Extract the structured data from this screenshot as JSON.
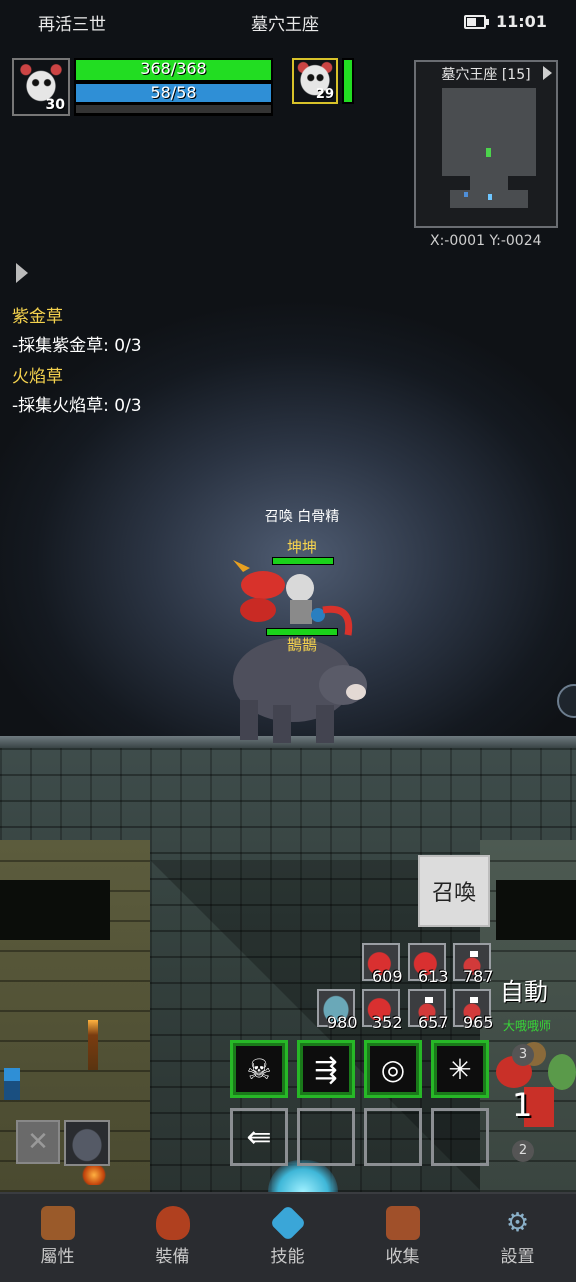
{
  "status_bar": {
    "left_text": "再活三世",
    "center_text": "墓穴王座",
    "time": "11:01"
  },
  "player": {
    "level": "30",
    "hp_text": "368/368",
    "mp_text": "58/58"
  },
  "pet": {
    "level": "29"
  },
  "minimap": {
    "title": "墓穴王座 [15]",
    "coords": "X:-0001  Y:-0024"
  },
  "quests": [
    {
      "title": "紫金草",
      "line": "-採集紫金草: 0/3"
    },
    {
      "title": "火焰草",
      "line": "-採集火焰草: 0/3"
    }
  ],
  "creatures": {
    "summon_label": "召喚 白骨精",
    "name_top": "坤坤",
    "name_bottom": "鵲鵲"
  },
  "summon_button": {
    "label": "召喚"
  },
  "items": [
    {
      "icon": "meat-icon",
      "count": "609"
    },
    {
      "icon": "meat-icon",
      "count": "613"
    },
    {
      "icon": "potion-icon",
      "count": "787"
    },
    {
      "icon": "fish-icon",
      "count": "980"
    },
    {
      "icon": "meat-icon",
      "count": "352"
    },
    {
      "icon": "potion-icon",
      "count": "657"
    },
    {
      "icon": "potion-icon",
      "count": "965"
    }
  ],
  "auto_button": {
    "label": "自動"
  },
  "ally": {
    "name": "大哦哦师",
    "count": "1",
    "badge_top": "3",
    "badge_bottom": "2"
  },
  "skills": [
    {
      "icon": "horned-skull-icon"
    },
    {
      "icon": "spray-icon"
    },
    {
      "icon": "vortex-icon"
    },
    {
      "icon": "burst-icon"
    }
  ],
  "skill_row2": [
    {
      "icon": "back-arrow-icon"
    }
  ],
  "nav": [
    {
      "icon": "helmet-icon",
      "label": "屬性"
    },
    {
      "icon": "bag-icon",
      "label": "裝備"
    },
    {
      "icon": "gem-icon",
      "label": "技能"
    },
    {
      "icon": "book-icon",
      "label": "收集"
    },
    {
      "icon": "gear-icon",
      "label": "設置"
    }
  ],
  "colors": {
    "hp": "#22dd22",
    "mp": "#2f8fd6",
    "skill_border": "#27b827",
    "quest_title": "#f4d24e"
  }
}
